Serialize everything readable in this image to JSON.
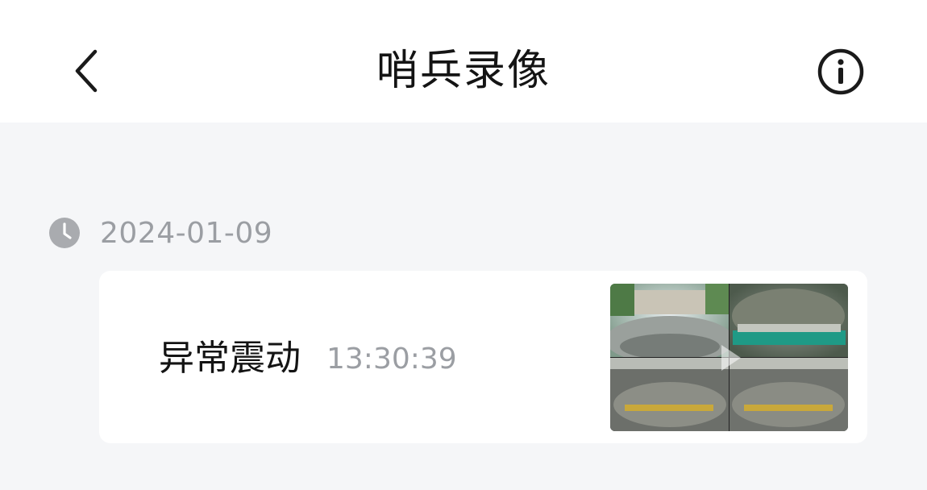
{
  "header": {
    "title": "哨兵录像",
    "back_icon": "chevron-left-icon",
    "info_icon": "info-circle-icon"
  },
  "records": [
    {
      "date": "2024-01-09",
      "date_icon": "clock-icon",
      "items": [
        {
          "title": "异常震动",
          "time": "13:30:39",
          "thumbnail": "four-camera-surround-view-thumbnail"
        }
      ]
    }
  ],
  "colors": {
    "page_bg": "#f5f6f8",
    "card_bg": "#ffffff",
    "secondary_text": "#9b9ea3",
    "primary_text": "#141414"
  }
}
